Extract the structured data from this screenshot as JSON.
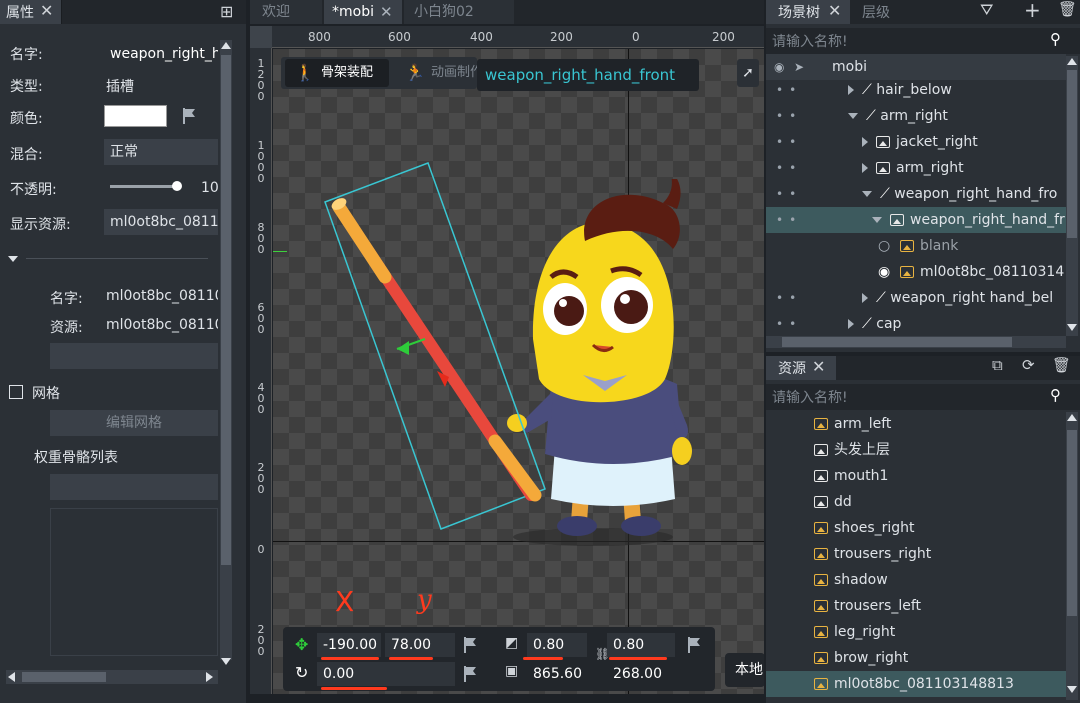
{
  "left_panel": {
    "tab_label": "属性",
    "name_label": "名字:",
    "name_value": "weapon_right_h",
    "type_label": "类型:",
    "type_value": "插槽",
    "color_label": "颜色:",
    "blend_label": "混合:",
    "blend_value": "正常",
    "opacity_label": "不透明:",
    "opacity_value": "10",
    "opacity_level": 0.95,
    "display_label": "显示资源:",
    "display_value": "ml0ot8bc_0811",
    "sub_name_label": "名字:",
    "sub_name_value": "ml0ot8bc_08110",
    "sub_res_label": "资源:",
    "sub_res_value": "ml0ot8bc_08110",
    "mesh_label": "网格",
    "edit_mesh_button": "编辑网格",
    "weight_bone_list_label": "权重骨骼列表"
  },
  "editor_tabs": [
    {
      "label": "欢迎"
    },
    {
      "label": "*mobi"
    },
    {
      "label": "小白狗02"
    }
  ],
  "ruler": {
    "top": [
      "800",
      "600",
      "400",
      "200",
      "0",
      "200"
    ],
    "left": [
      [
        "1",
        "2",
        "0",
        "0"
      ],
      [
        "1",
        "0",
        "0",
        "0"
      ],
      [
        "8",
        "0",
        "0"
      ],
      [
        "6",
        "0",
        "0"
      ],
      [
        "4",
        "0",
        "0"
      ],
      [
        "2",
        "0",
        "0"
      ],
      [
        "0"
      ],
      [
        "2",
        "0",
        "0"
      ]
    ]
  },
  "viewport": {
    "mode_skeleton": "骨架装配",
    "mode_animation": "动画制作",
    "selected_name": "weapon_right_hand_front",
    "annotation_x": "X",
    "annotation_y": "y"
  },
  "transform": {
    "pos_x": "-190.00",
    "pos_y": "78.00",
    "rotation": "0.00",
    "scale_x": "0.80",
    "scale_y": "0.80",
    "width": "865.60",
    "height": "268.00",
    "side_button": "本地"
  },
  "scene_tree": {
    "tab_label": "场景树",
    "tab2_label": "层级",
    "search_placeholder": "请输入名称!",
    "root": "mobi",
    "items": [
      {
        "label": "hair_below"
      },
      {
        "label": "arm_right"
      },
      {
        "label": "jacket_right"
      },
      {
        "label": "arm_right"
      },
      {
        "label": "weapon_right_hand_fro"
      },
      {
        "label": "weapon_right_hand_fr"
      },
      {
        "label": "blank"
      },
      {
        "label": "ml0ot8bc_08110314"
      },
      {
        "label": "weapon_right hand_bel"
      },
      {
        "label": "cap"
      }
    ]
  },
  "assets": {
    "tab_label": "资源",
    "search_placeholder": "请输入名称!",
    "items": [
      {
        "label": "arm_left"
      },
      {
        "label": "头发上层"
      },
      {
        "label": "mouth1"
      },
      {
        "label": "dd"
      },
      {
        "label": "shoes_right"
      },
      {
        "label": "trousers_right"
      },
      {
        "label": "shadow"
      },
      {
        "label": "trousers_left"
      },
      {
        "label": "leg_right"
      },
      {
        "label": "brow_right"
      },
      {
        "label": "ml0ot8bc_081103148813"
      }
    ]
  },
  "colors": {
    "accent": "#39c6d2",
    "selection": "#3d5a5e",
    "annotation": "#ff3a1e"
  }
}
